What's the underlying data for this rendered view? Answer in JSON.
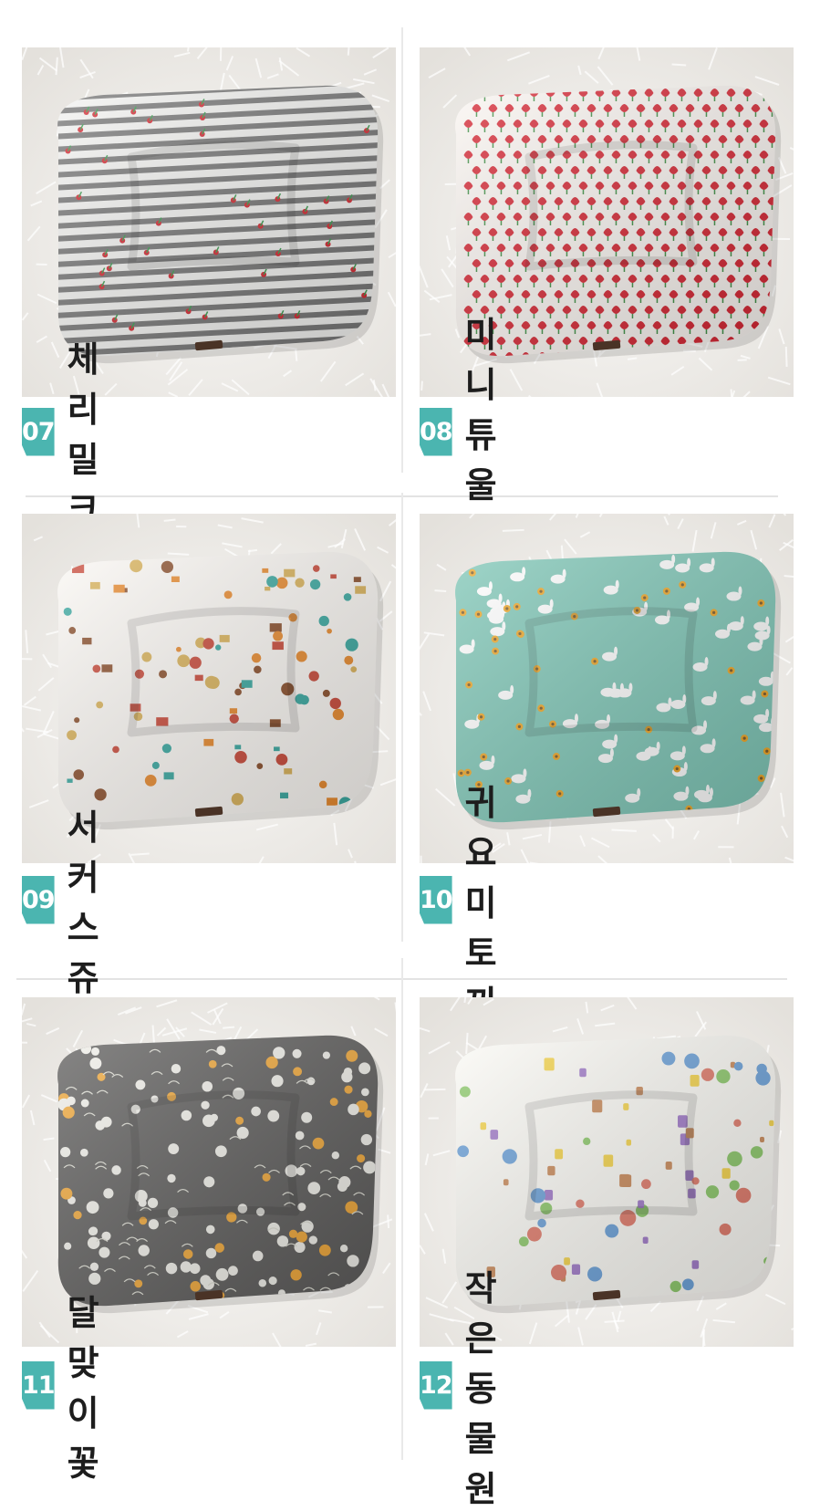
{
  "products": [
    {
      "number": "07",
      "name": "체리 밀크",
      "pattern": "cherry-stripe",
      "colors": {
        "base": "#f4f4f2",
        "primary": "#777777",
        "accent": "#d52b34",
        "leaf": "#3a9d4f"
      }
    },
    {
      "number": "08",
      "name": "미니 튜울립",
      "pattern": "tulip",
      "colors": {
        "base": "#fbf6f2",
        "primary": "#d62633",
        "accent": "#d62633",
        "leaf": "#3e8f44"
      }
    },
    {
      "number": "09",
      "name": "서커스 쥬",
      "pattern": "circus-zoo",
      "colors": {
        "base": "#fbf8f4",
        "primary": "#8a4f2c",
        "accent": "#e88a2e",
        "leaf": "#3aa8a0"
      }
    },
    {
      "number": "10",
      "name": "귀요미 토끼",
      "pattern": "bunny",
      "colors": {
        "base": "#7fc7b7",
        "primary": "#ffffff",
        "accent": "#f0a726",
        "leaf": "#5a8f4a"
      }
    },
    {
      "number": "11",
      "name": "달맞이꽃",
      "pattern": "evening-primrose",
      "colors": {
        "base": "#5e5d5c",
        "primary": "#f1f0ea",
        "accent": "#f0a83a",
        "leaf": "#dcdcd2"
      }
    },
    {
      "number": "12",
      "name": "작은 동물원",
      "pattern": "small-zoo",
      "colors": {
        "base": "#fbfaf5",
        "primary": "#8cc86a",
        "accent": "#f4d34a",
        "leaf": "#6aa0d8"
      }
    }
  ],
  "theme": {
    "badge_color": "#4bb5b0",
    "rug_color": "#f1efec"
  }
}
